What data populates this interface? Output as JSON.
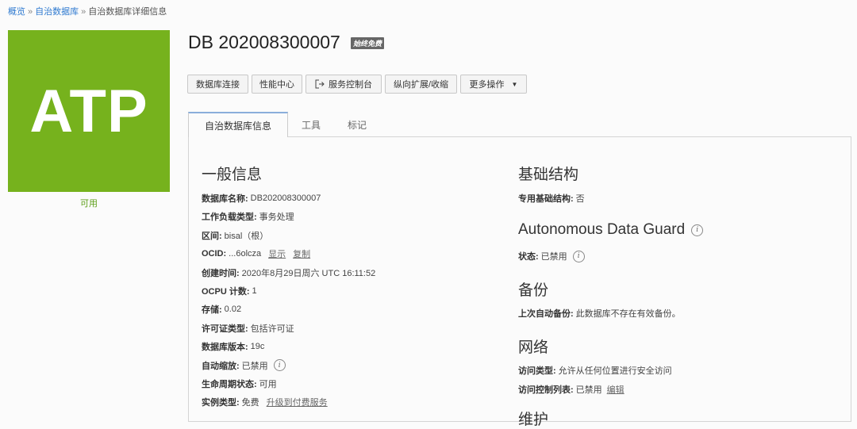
{
  "breadcrumb": [
    "概览",
    "自治数据库",
    "自治数据库详细信息"
  ],
  "logo": {
    "text": "ATP",
    "color": "#76b21d"
  },
  "status": "可用",
  "title": "DB 202008300007",
  "badge": "始终免费",
  "buttons": [
    "数据库连接",
    "性能中心",
    "服务控制台",
    "纵向扩展/收缩",
    "更多操作"
  ],
  "tabs": [
    "自治数据库信息",
    "工具",
    "标记"
  ],
  "general": {
    "heading": "一般信息",
    "rows": [
      {
        "label": "数据库名称:",
        "value": "DB202008300007"
      },
      {
        "label": "工作负载类型:",
        "value": "事务处理"
      },
      {
        "label": "区间:",
        "value": "bisal（根）"
      },
      {
        "label": "OCID:",
        "value": "...6olcza",
        "link1": "显示",
        "link2": "复制"
      },
      {
        "label": "创建时间:",
        "value": "2020年8月29日周六 UTC 16:11:52"
      },
      {
        "label": "OCPU 计数:",
        "value": "1"
      },
      {
        "label": "存储:",
        "value": "0.02"
      },
      {
        "label": "许可证类型:",
        "value": "包括许可证"
      },
      {
        "label": "数据库版本:",
        "value": "19c"
      },
      {
        "label": "自动缩放:",
        "value": "已禁用"
      },
      {
        "label": "生命周期状态:",
        "value": "可用"
      },
      {
        "label": "实例类型:",
        "value": "免费",
        "link1": "升级到付费服务"
      }
    ]
  },
  "infra": {
    "heading": "基础结构",
    "label": "专用基础结构:",
    "value": "否"
  },
  "adg": {
    "heading": "Autonomous Data Guard",
    "label": "状态:",
    "value": "已禁用"
  },
  "backup": {
    "heading": "备份",
    "label": "上次自动备份:",
    "value": "此数据库不存在有效备份。"
  },
  "network": {
    "heading": "网络",
    "rows": [
      {
        "label": "访问类型:",
        "value": "允许从任何位置进行安全访问"
      },
      {
        "label": "访问控制列表:",
        "value": "已禁用",
        "link1": "编辑"
      }
    ]
  },
  "next_heading": "维护"
}
